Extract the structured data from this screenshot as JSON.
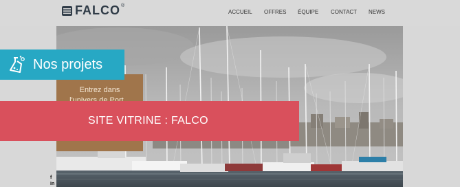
{
  "header": {
    "logo_text": "FALCO",
    "logo_mark": "®",
    "nav": [
      "ACCUEIL",
      "OFFRES",
      "ÉQUIPE",
      "CONTACT",
      "NEWS"
    ]
  },
  "hero": {
    "cta_line1": "Entrez dans",
    "cta_line2": "l'univers de Port..."
  },
  "social": {
    "facebook": "f",
    "linkedin": "in"
  },
  "badge": {
    "label": "Nos projets",
    "icon": "flask-icon"
  },
  "banner": {
    "title": "SITE VITRINE : FALCO"
  },
  "colors": {
    "badge_bg": "#27a8c4",
    "banner_bg": "#d9505c",
    "cta_bg": "#a0754b",
    "logo": "#2f3b47"
  }
}
